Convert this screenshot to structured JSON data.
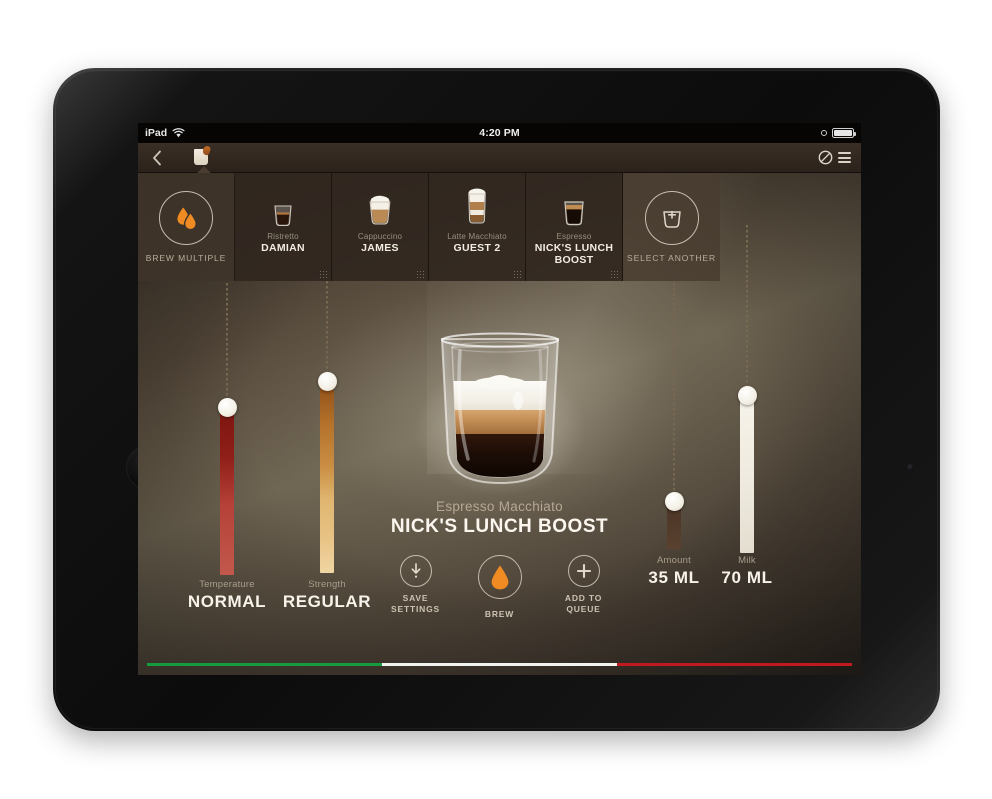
{
  "status_bar": {
    "device_label": "iPad",
    "wifi_icon": "wifi-icon",
    "time": "4:20 PM",
    "bluetooth_icon": "bluetooth-icon",
    "battery_icon": "battery-icon"
  },
  "nav_bar": {
    "back_icon": "back-chevron-icon",
    "tab_icon": "coffee-cup-tab-icon",
    "bean_icon": "coffee-bean-icon",
    "menu_icon": "hamburger-menu-icon"
  },
  "carousel": {
    "brew_multiple": {
      "label": "BREW MULTIPLE",
      "icon": "double-drop-icon"
    },
    "items": [
      {
        "type": "Ristretto",
        "name": "DAMIAN",
        "icon": "ristretto-cup-icon"
      },
      {
        "type": "Cappuccino",
        "name": "JAMES",
        "icon": "cappuccino-cup-icon"
      },
      {
        "type": "Latte Macchiato",
        "name": "GUEST 2",
        "icon": "latte-macchiato-glass-icon"
      },
      {
        "type": "Espresso",
        "name": "NICK'S LUNCH BOOST",
        "icon": "espresso-cup-icon"
      }
    ],
    "select_another": {
      "label": "SELECT ANOTHER",
      "icon": "add-cup-icon"
    }
  },
  "drink": {
    "type": "Espresso Macchiato",
    "name": "NICK'S LUNCH BOOST",
    "cup_icon": "double-wall-glass-icon"
  },
  "sliders": [
    {
      "id": "temperature",
      "title": "Temperature",
      "value": "NORMAL",
      "knob_icon": "slider-knob-icon",
      "accent": "#8f1f18"
    },
    {
      "id": "strength",
      "title": "Strength",
      "value": "REGULAR",
      "knob_icon": "slider-knob-icon",
      "accent": "#a8621f"
    },
    {
      "id": "amount",
      "title": "Amount",
      "value": "35 ML",
      "knob_icon": "slider-knob-icon",
      "accent": "#4a3425"
    },
    {
      "id": "milk",
      "title": "Milk",
      "value": "70 ML",
      "knob_icon": "slider-knob-icon",
      "accent": "#efeadf"
    }
  ],
  "actions": [
    {
      "id": "save-settings",
      "label": "SAVE\nSETTINGS",
      "line1": "SAVE",
      "line2": "SETTINGS",
      "icon": "download-icon"
    },
    {
      "id": "brew",
      "label": "BREW",
      "line1": "BREW",
      "line2": "",
      "icon": "drop-icon"
    },
    {
      "id": "add-to-queue",
      "label": "ADD TO\nQUEUE",
      "line1": "ADD TO",
      "line2": "QUEUE",
      "icon": "plus-icon"
    }
  ],
  "theme": {
    "brew_orange": "#ef8b22",
    "flag_green": "#169b3f",
    "flag_white": "#f2f2ee",
    "flag_red": "#c0191f"
  }
}
